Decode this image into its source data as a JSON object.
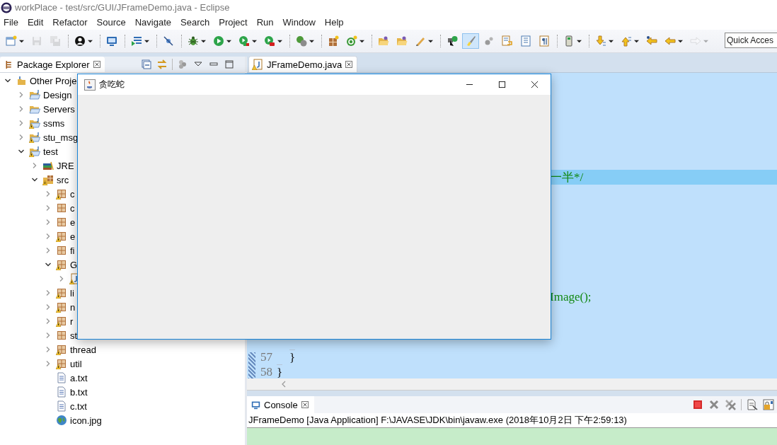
{
  "app_title": "workPlace - test/src/GUI/JFrameDemo.java - Eclipse",
  "menu": [
    "File",
    "Edit",
    "Refactor",
    "Source",
    "Navigate",
    "Search",
    "Project",
    "Run",
    "Window",
    "Help"
  ],
  "toolbar": [
    {
      "kind": "new",
      "dropdown": true,
      "disabled": false,
      "on": false
    },
    {
      "kind": "save",
      "dropdown": false,
      "disabled": true,
      "on": false
    },
    {
      "kind": "save-all",
      "dropdown": false,
      "disabled": true,
      "on": false
    },
    {
      "kind": "separator"
    },
    {
      "kind": "person",
      "dropdown": true,
      "disabled": false,
      "on": false
    },
    {
      "kind": "separator"
    },
    {
      "kind": "monitor",
      "dropdown": false,
      "disabled": false,
      "on": false
    },
    {
      "kind": "separator"
    },
    {
      "kind": "list",
      "dropdown": true,
      "disabled": false,
      "on": false
    },
    {
      "kind": "separator"
    },
    {
      "kind": "pin-off",
      "dropdown": false,
      "disabled": false,
      "on": false
    },
    {
      "kind": "separator"
    },
    {
      "kind": "bug",
      "dropdown": true,
      "disabled": false,
      "on": false
    },
    {
      "kind": "run",
      "dropdown": true,
      "disabled": false,
      "on": false
    },
    {
      "kind": "coverage",
      "dropdown": true,
      "disabled": false,
      "on": false
    },
    {
      "kind": "external",
      "dropdown": true,
      "disabled": false,
      "on": false
    },
    {
      "kind": "separator"
    },
    {
      "kind": "refresh",
      "dropdown": true,
      "disabled": false,
      "on": false
    },
    {
      "kind": "separator"
    },
    {
      "kind": "package",
      "dropdown": false,
      "disabled": false,
      "on": false
    },
    {
      "kind": "class",
      "dropdown": true,
      "disabled": false,
      "on": false
    },
    {
      "kind": "separator"
    },
    {
      "kind": "folder",
      "dropdown": false,
      "disabled": false,
      "on": false
    },
    {
      "kind": "folder",
      "dropdown": false,
      "disabled": false,
      "on": false
    },
    {
      "kind": "pen",
      "dropdown": true,
      "disabled": false,
      "on": false
    },
    {
      "kind": "separator"
    },
    {
      "kind": "terminal",
      "dropdown": false,
      "disabled": false,
      "on": false
    },
    {
      "kind": "brush",
      "dropdown": false,
      "disabled": false,
      "on": true
    },
    {
      "kind": "gears",
      "dropdown": false,
      "disabled": false,
      "on": false
    },
    {
      "kind": "wrap",
      "dropdown": false,
      "disabled": false,
      "on": false
    },
    {
      "kind": "block",
      "dropdown": false,
      "disabled": false,
      "on": false
    },
    {
      "kind": "whitespace",
      "dropdown": false,
      "disabled": false,
      "on": false
    },
    {
      "kind": "separator"
    },
    {
      "kind": "device",
      "dropdown": true,
      "disabled": false,
      "on": false
    },
    {
      "kind": "separator"
    },
    {
      "kind": "next",
      "dropdown": true,
      "disabled": false,
      "on": false
    },
    {
      "kind": "prev",
      "dropdown": true,
      "disabled": false,
      "on": false
    },
    {
      "kind": "last-edit",
      "dropdown": false,
      "disabled": false,
      "on": false
    },
    {
      "kind": "back",
      "dropdown": true,
      "disabled": false,
      "on": false
    },
    {
      "kind": "forward",
      "dropdown": true,
      "disabled": true,
      "on": false
    }
  ],
  "quick_access": {
    "placeholder": "Quick Acces"
  },
  "package_explorer": {
    "title": "Package Explorer",
    "tree": [
      {
        "label": "Other Proje",
        "kind": "workingset",
        "warning": false,
        "expanded": true,
        "children": [
          {
            "label": "Design",
            "kind": "project",
            "warning": false,
            "expanded": false
          },
          {
            "label": "Servers",
            "kind": "folder",
            "warning": false,
            "expanded": false
          },
          {
            "label": "ssms",
            "kind": "project",
            "warning": true,
            "expanded": false
          },
          {
            "label": "stu_msg",
            "kind": "project",
            "warning": true,
            "expanded": false
          },
          {
            "label": "test",
            "kind": "project",
            "warning": true,
            "expanded": true,
            "children": [
              {
                "label": "JRE",
                "kind": "library",
                "warning": false,
                "expanded": false
              },
              {
                "label": "src",
                "kind": "source",
                "warning": true,
                "expanded": true,
                "children": [
                  {
                    "label": "c",
                    "kind": "package",
                    "warning": true,
                    "expanded": false
                  },
                  {
                    "label": "c",
                    "kind": "package",
                    "warning": false,
                    "expanded": false
                  },
                  {
                    "label": "e",
                    "kind": "package",
                    "warning": false,
                    "expanded": false
                  },
                  {
                    "label": "e",
                    "kind": "package",
                    "warning": true,
                    "expanded": false
                  },
                  {
                    "label": "fi",
                    "kind": "package",
                    "warning": false,
                    "expanded": false
                  },
                  {
                    "label": "G",
                    "kind": "package",
                    "warning": true,
                    "expanded": true,
                    "children": [
                      {
                        "kind": "java",
                        "warning": true,
                        "expanded": false
                      }
                    ]
                  },
                  {
                    "label": "li",
                    "kind": "package",
                    "warning": true,
                    "expanded": false
                  },
                  {
                    "label": "n",
                    "kind": "package",
                    "warning": true,
                    "expanded": false
                  },
                  {
                    "label": "r",
                    "kind": "package",
                    "warning": true,
                    "expanded": false
                  },
                  {
                    "label": "st",
                    "kind": "package",
                    "warning": false,
                    "expanded": false
                  },
                  {
                    "label": "thread",
                    "kind": "package",
                    "warning": true,
                    "expanded": false
                  },
                  {
                    "label": "util",
                    "kind": "package",
                    "warning": true,
                    "expanded": false
                  },
                  {
                    "label": "a.txt",
                    "kind": "file",
                    "warning": false
                  },
                  {
                    "label": "b.txt",
                    "kind": "file",
                    "warning": false
                  },
                  {
                    "label": "c.txt",
                    "kind": "file",
                    "warning": false
                  },
                  {
                    "label": "icon.jpg",
                    "kind": "image",
                    "warning": false
                  }
                ]
              }
            ]
          }
        ]
      }
    ]
  },
  "editor": {
    "tab": "JFrameDemo.java",
    "lines": [
      {
        "text": "一半*/",
        "kind": "comment",
        "current": true
      },
      {
        "text": "Image();",
        "kind": "comment",
        "current": false
      },
      {
        "number": "57",
        "text": "}",
        "kind": "code",
        "indent": true,
        "current": false
      },
      {
        "number": "58",
        "text": "}",
        "kind": "code",
        "indent": false,
        "current": false
      }
    ]
  },
  "console": {
    "title": "Console",
    "description": "JFrameDemo [Java Application] F:\\JAVASE\\JDK\\bin\\javaw.exe (2018年10月2日 下午2:59:13)"
  },
  "dialog": {
    "title": "贪吃蛇"
  }
}
